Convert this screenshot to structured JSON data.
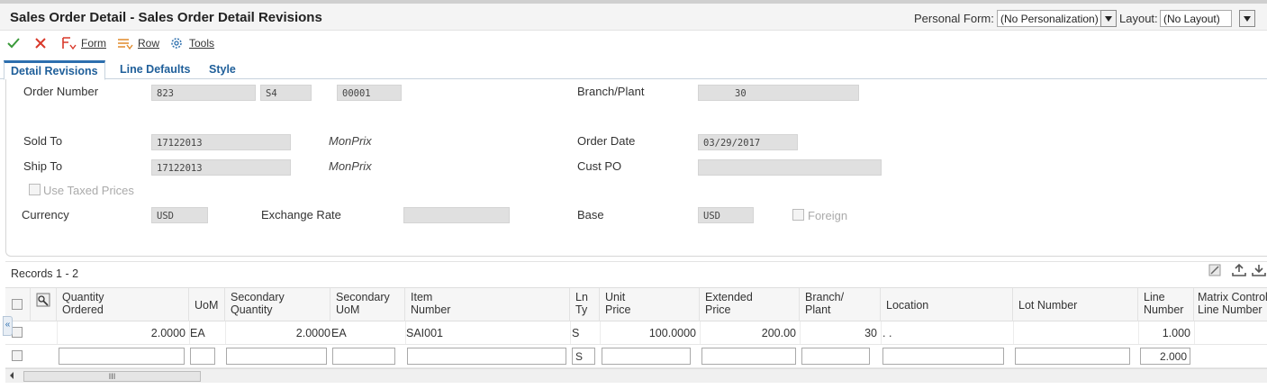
{
  "header": {
    "title": "Sales Order Detail - Sales Order Detail Revisions",
    "personal_form_label": "Personal Form:",
    "personal_form_value": "(No Personalization)",
    "layout_label": "Layout:",
    "layout_value": "(No Layout)"
  },
  "toolbar": {
    "ok_icon": "check-icon",
    "cancel_icon": "close-icon",
    "form_label": "Form",
    "row_label": "Row",
    "tools_label": "Tools"
  },
  "tabs": [
    {
      "label": "Detail Revisions",
      "active": true
    },
    {
      "label": "Line Defaults",
      "active": false
    },
    {
      "label": "Style",
      "active": false
    }
  ],
  "form": {
    "order_number_label": "Order Number",
    "order_number": "823",
    "order_type": "S4",
    "order_company": "00001",
    "branch_plant_label": "Branch/Plant",
    "branch_plant": "30",
    "sold_to_label": "Sold To",
    "sold_to": "17122013",
    "sold_to_name": "MonPrix",
    "order_date_label": "Order Date",
    "order_date": "03/29/2017",
    "ship_to_label": "Ship To",
    "ship_to": "17122013",
    "ship_to_name": "MonPrix",
    "cust_po_label": "Cust PO",
    "cust_po": "",
    "use_taxed_prices_label": "Use Taxed Prices",
    "currency_label": "Currency",
    "currency": "USD",
    "exchange_rate_label": "Exchange Rate",
    "exchange_rate": "",
    "base_label": "Base",
    "base": "USD",
    "foreign_label": "Foreign"
  },
  "grid": {
    "records_label": "Records 1 - 2",
    "columns": {
      "qty_ordered": "Quantity\nOrdered",
      "uom": "UoM",
      "secondary_qty": "Secondary\nQuantity",
      "secondary_uom": "Secondary\nUoM",
      "item_number": "Item\nNumber",
      "ln_ty": "Ln\nTy",
      "unit_price": "Unit\nPrice",
      "extended_price": "Extended\nPrice",
      "branch_plant": "Branch/\nPlant",
      "location": "Location",
      "lot_number": "Lot Number",
      "line_number": "Line\nNumber",
      "matrix_control": "Matrix Control\nLine Number"
    },
    "rows": [
      {
        "qty_ordered": "2.0000",
        "uom": "EA",
        "secondary_qty": "2.0000",
        "secondary_uom": "EA",
        "item_number": "SAI001",
        "ln_ty": "S",
        "unit_price": "100.0000",
        "extended_price": "200.00",
        "branch_plant": "30",
        "location": ". .",
        "lot_number": "",
        "line_number": "1.000",
        "matrix_control": ""
      }
    ],
    "new_row": {
      "ln_ty": "S",
      "line_number": "2.000"
    }
  },
  "scrollbar": {
    "thumb_label": "III"
  },
  "colors": {
    "accent": "#2d6fae",
    "ok_green": "#3a9a3a",
    "cancel_red": "#d9382a",
    "field_gray": "#e0e0e0"
  }
}
